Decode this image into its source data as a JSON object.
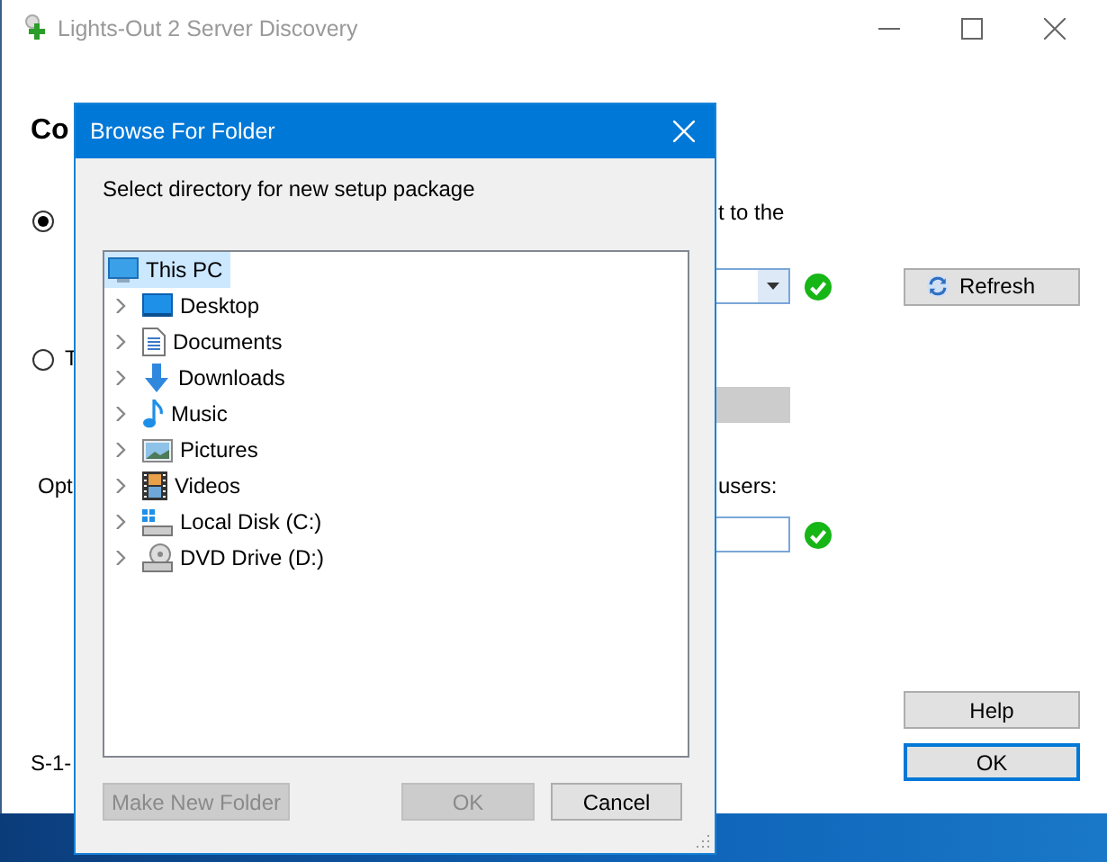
{
  "window": {
    "title": "Lights-Out 2 Server Discovery"
  },
  "main": {
    "heading": "Co",
    "options": [
      {
        "trailing": "t to the",
        "selected": true
      },
      {
        "lines": [
          "T"
        ],
        "selected": false
      }
    ],
    "refresh_button": "Refresh",
    "optional_label": "Opt",
    "users_label": "users:",
    "help_button": "Help",
    "ok_button": "OK",
    "footer_text": "S-1-"
  },
  "dialog": {
    "title": "Browse For Folder",
    "prompt": "Select directory for new setup package",
    "tree": [
      {
        "label": "This PC",
        "kind": "pc",
        "selected": true,
        "children": [
          {
            "label": "Desktop",
            "kind": "desktop",
            "selected": false,
            "expanded": false
          },
          {
            "label": "Documents",
            "kind": "documents",
            "selected": false,
            "expanded": false
          },
          {
            "label": "Downloads",
            "kind": "downloads",
            "selected": false,
            "expanded": false
          },
          {
            "label": "Music",
            "kind": "music",
            "selected": false,
            "expanded": false
          },
          {
            "label": "Pictures",
            "kind": "pictures",
            "selected": false,
            "expanded": false
          },
          {
            "label": "Videos",
            "kind": "videos",
            "selected": false,
            "expanded": false
          },
          {
            "label": "Local Disk (C:)",
            "kind": "disk",
            "selected": false,
            "expanded": false
          },
          {
            "label": "DVD Drive (D:)",
            "kind": "dvd",
            "selected": false,
            "expanded": false
          }
        ]
      }
    ],
    "buttons": [
      {
        "label": "Make New Folder",
        "disabled": true
      },
      {
        "label": "OK",
        "disabled": true
      },
      {
        "label": "Cancel",
        "disabled": false
      }
    ]
  }
}
